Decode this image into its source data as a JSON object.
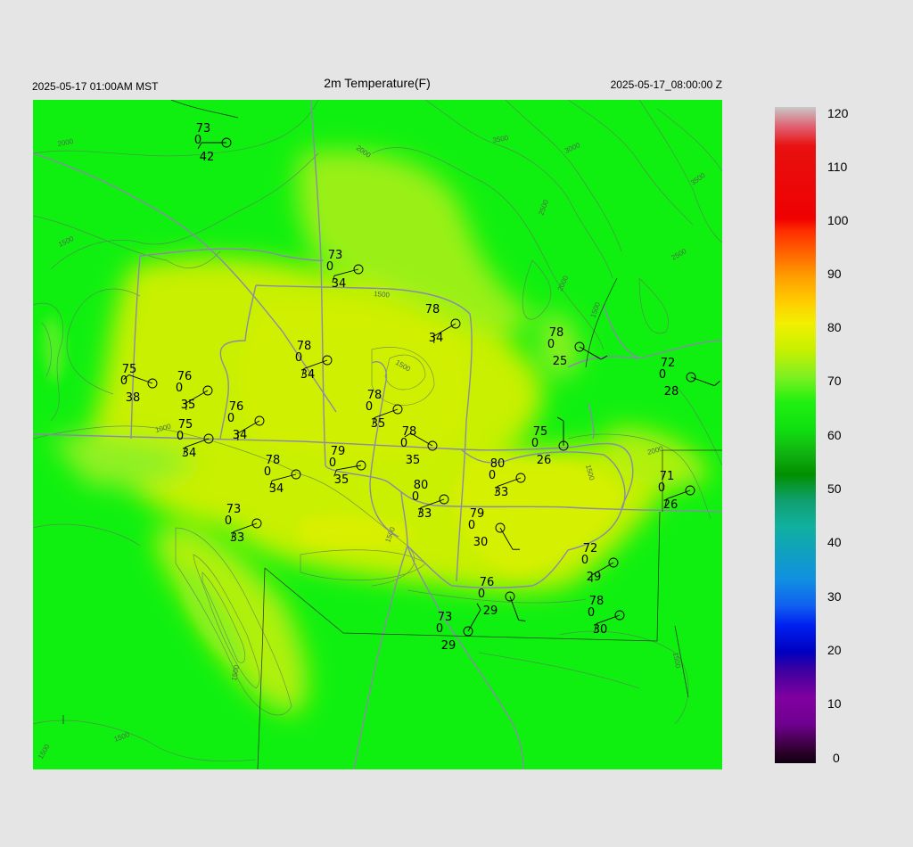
{
  "header": {
    "local_time": "2025-05-17 01:00AM MST",
    "title": "2m Temperature(F)",
    "utc_time": "2025-05-17_08:00:00 Z"
  },
  "colorbar": {
    "ticks": [
      "120",
      "110",
      "100",
      "90",
      "80",
      "70",
      "60",
      "50",
      "40",
      "30",
      "20",
      "10",
      "0"
    ]
  },
  "map": {
    "contour_labels": [
      "2000",
      "2000",
      "3000",
      "3500",
      "3500",
      "2500",
      "2500",
      "2000",
      "1500",
      "1500",
      "1500",
      "1500",
      "1000",
      "1500",
      "2000",
      "1500",
      "1500",
      "1500",
      "1500",
      "1500"
    ],
    "stations": [
      {
        "t": "73",
        "d": "42",
        "p": "0"
      },
      {
        "t": "73",
        "d": "34",
        "p": "0"
      },
      {
        "t": "78",
        "d": "34",
        "p": ""
      },
      {
        "t": "78",
        "d": "34",
        "p": "0"
      },
      {
        "t": "78",
        "d": "25",
        "p": "0"
      },
      {
        "t": "72",
        "d": "28",
        "p": "0"
      },
      {
        "t": "75",
        "d": "38",
        "p": "0"
      },
      {
        "t": "76",
        "d": "35",
        "p": "0"
      },
      {
        "t": "78",
        "d": "35",
        "p": "0"
      },
      {
        "t": "76",
        "d": "34",
        "p": "0"
      },
      {
        "t": "75",
        "d": "34",
        "p": "0"
      },
      {
        "t": "78",
        "d": "35",
        "p": "0"
      },
      {
        "t": "79",
        "d": "35",
        "p": "0"
      },
      {
        "t": "78",
        "d": "34",
        "p": "0"
      },
      {
        "t": "75",
        "d": "26",
        "p": "0"
      },
      {
        "t": "80",
        "d": "33",
        "p": "0"
      },
      {
        "t": "80",
        "d": "33",
        "p": "0"
      },
      {
        "t": "71",
        "d": "26",
        "p": "0"
      },
      {
        "t": "73",
        "d": "33",
        "p": "0"
      },
      {
        "t": "79",
        "d": "30",
        "p": "0"
      },
      {
        "t": "72",
        "d": "29",
        "p": "0"
      },
      {
        "t": "76",
        "d": "29",
        "p": "0"
      },
      {
        "t": "78",
        "d": "30",
        "p": "0"
      },
      {
        "t": "73",
        "d": "29",
        "p": "0"
      }
    ]
  }
}
